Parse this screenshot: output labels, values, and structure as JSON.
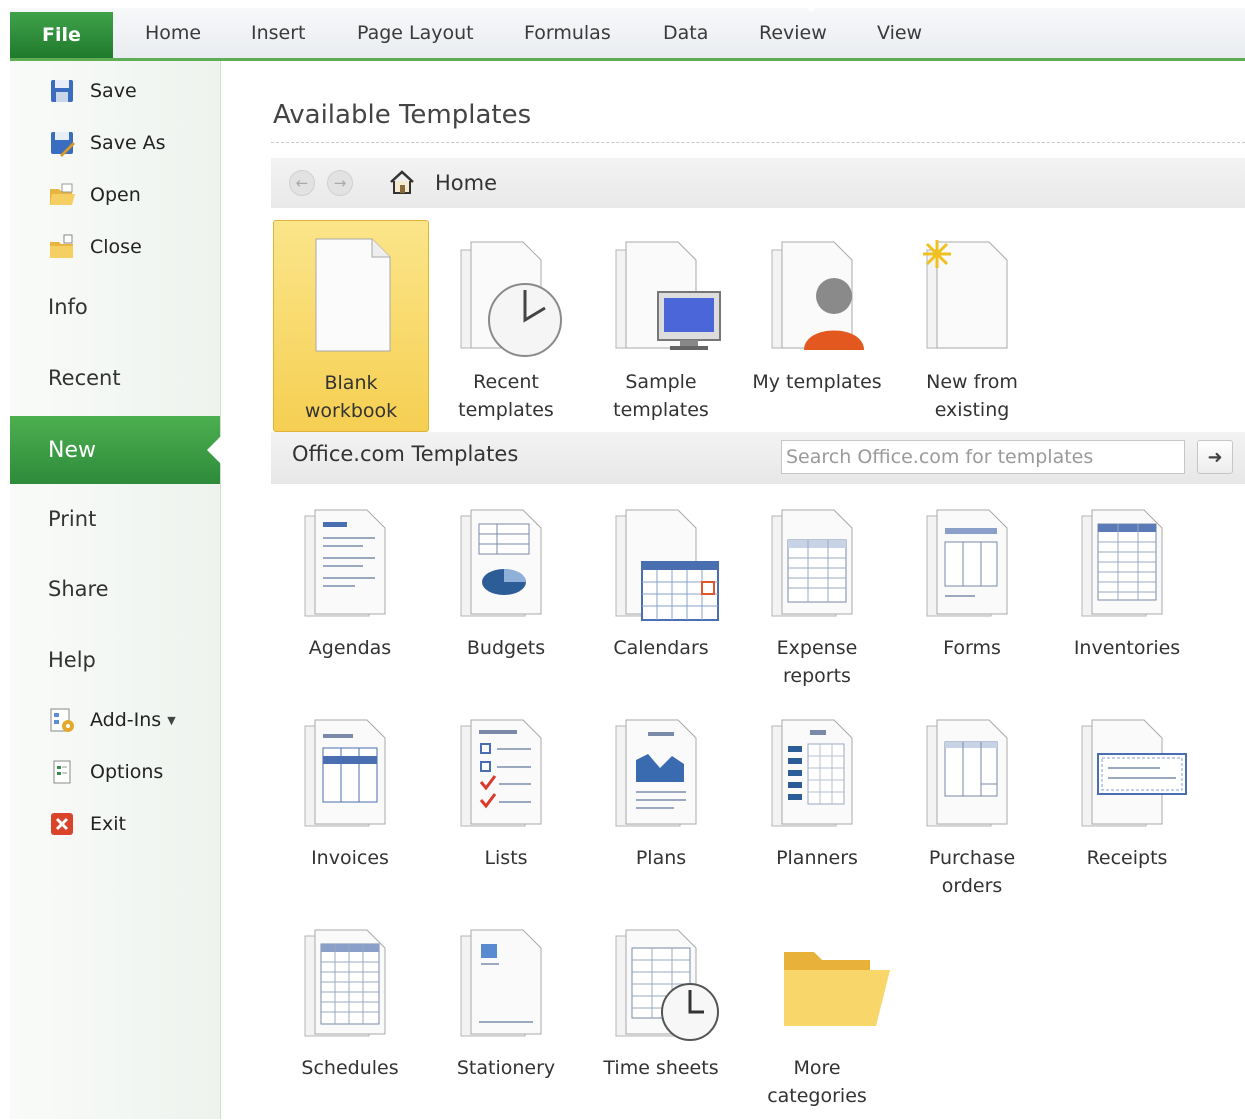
{
  "ribbon": {
    "file": "File",
    "tabs": [
      "Home",
      "Insert",
      "Page Layout",
      "Formulas",
      "Data",
      "Review",
      "View"
    ]
  },
  "nav": {
    "save": "Save",
    "save_as": "Save As",
    "open": "Open",
    "close": "Close",
    "info": "Info",
    "recent": "Recent",
    "new": "New",
    "print": "Print",
    "share": "Share",
    "help": "Help",
    "addins": "Add-Ins",
    "options": "Options",
    "exit": "Exit"
  },
  "main": {
    "title": "Available Templates",
    "home": "Home"
  },
  "templates": {
    "blank": [
      "Blank",
      "workbook"
    ],
    "recent": [
      "Recent",
      "templates"
    ],
    "sample": [
      "Sample",
      "templates"
    ],
    "my": [
      "My templates"
    ],
    "new_from": [
      "New from",
      "existing"
    ]
  },
  "office": {
    "title": "Office.com Templates",
    "search_placeholder": "Search Office.com for templates",
    "categories": {
      "agendas": "Agendas",
      "budgets": "Budgets",
      "calendars": "Calendars",
      "expense": [
        "Expense",
        "reports"
      ],
      "forms": "Forms",
      "inventories": "Inventories",
      "invoices": "Invoices",
      "lists": "Lists",
      "plans": "Plans",
      "planners": "Planners",
      "purchase": [
        "Purchase",
        "orders"
      ],
      "receipts": "Receipts",
      "schedules": "Schedules",
      "stationery": "Stationery",
      "timesheets": "Time sheets",
      "more": [
        "More",
        "categories"
      ]
    }
  }
}
